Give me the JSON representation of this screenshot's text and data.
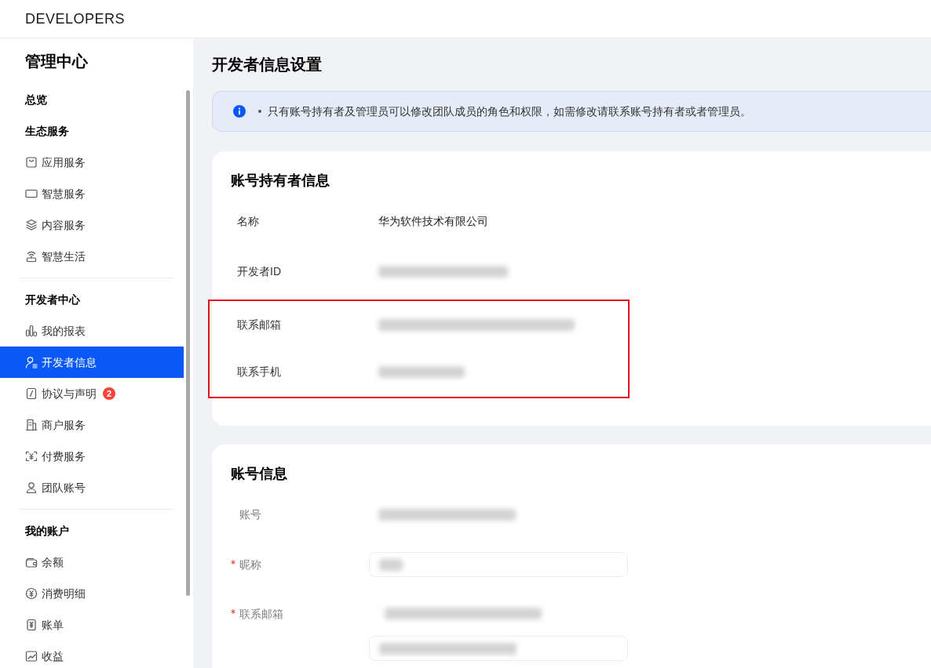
{
  "header": {
    "logo": "DEVELOPERS"
  },
  "sidebar": {
    "title": "管理中心",
    "sections": [
      {
        "heading": "总览"
      },
      {
        "heading": "生态服务",
        "items": [
          {
            "label": "应用服务",
            "selected": false
          },
          {
            "label": "智慧服务",
            "selected": false
          },
          {
            "label": "内容服务",
            "selected": false
          },
          {
            "label": "智慧生活",
            "selected": false
          }
        ]
      },
      {
        "heading": "开发者中心",
        "items": [
          {
            "label": "我的报表",
            "selected": false
          },
          {
            "label": "开发者信息",
            "selected": true
          },
          {
            "label": "协议与声明",
            "selected": false,
            "badge": "2"
          },
          {
            "label": "商户服务",
            "selected": false
          },
          {
            "label": "付费服务",
            "selected": false
          },
          {
            "label": "团队账号",
            "selected": false
          }
        ]
      },
      {
        "heading": "我的账户",
        "items": [
          {
            "label": "余额",
            "selected": false
          },
          {
            "label": "消费明细",
            "selected": false
          },
          {
            "label": "账单",
            "selected": false
          },
          {
            "label": "收益",
            "selected": false
          }
        ]
      }
    ]
  },
  "page": {
    "title": "开发者信息设置",
    "notice": "只有账号持有者及管理员可以修改团队成员的角色和权限，如需修改请联系账号持有者或者管理员。"
  },
  "cards": [
    {
      "title": "账号持有者信息",
      "obscured": false,
      "rows": [
        {
          "label": "名称",
          "kind": "text",
          "value": "华为软件技术有限公司",
          "highlighted": false
        },
        {
          "label": "开发者ID",
          "kind": "blurred",
          "highlighted": false
        },
        {
          "label": "联系邮箱",
          "kind": "blurred",
          "highlighted": true
        },
        {
          "label": "联系手机",
          "kind": "blurred",
          "highlighted": true
        }
      ]
    },
    {
      "title": "账号信息",
      "obscured": true,
      "rows": [
        {
          "label": "账号",
          "kind": "blurred",
          "required": false
        },
        {
          "label": "昵称",
          "kind": "input",
          "required": true
        },
        {
          "label": "联系邮箱",
          "kind": "blurred_input",
          "required": true
        }
      ]
    }
  ]
}
